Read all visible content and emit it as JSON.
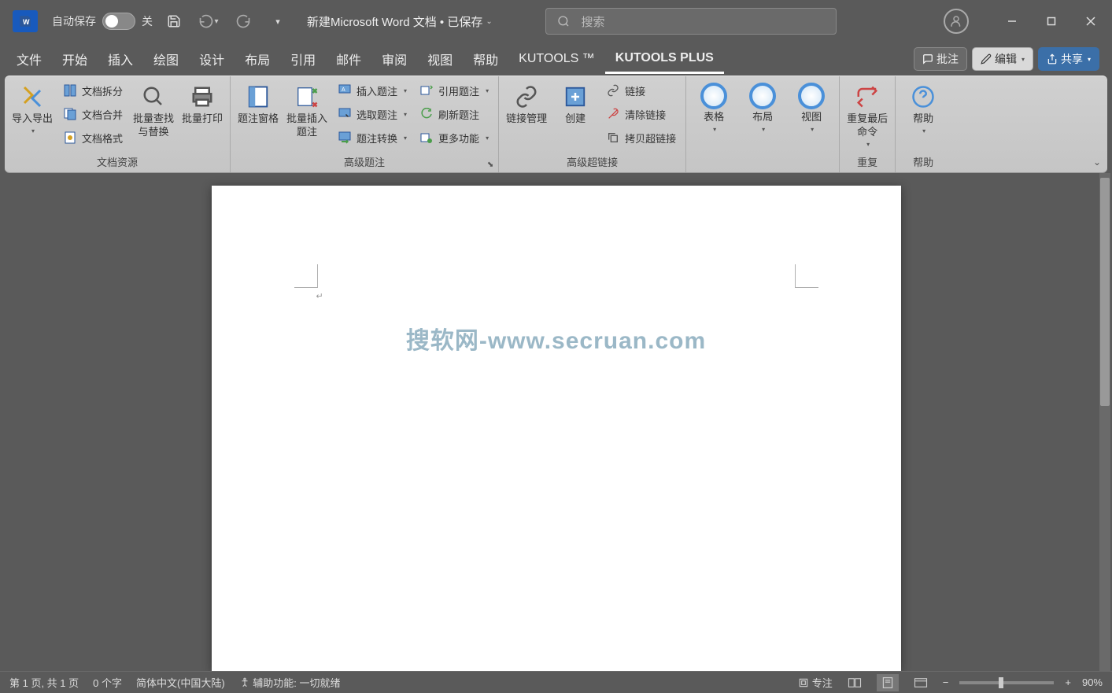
{
  "titlebar": {
    "autosave_label": "自动保存",
    "autosave_state": "关",
    "doc_title": "新建Microsoft Word 文档 • 已保存",
    "search_placeholder": "搜索"
  },
  "tabs": {
    "items": [
      "文件",
      "开始",
      "插入",
      "绘图",
      "设计",
      "布局",
      "引用",
      "邮件",
      "审阅",
      "视图",
      "帮助",
      "KUTOOLS ™",
      "KUTOOLS PLUS"
    ],
    "active_index": 12,
    "comments": "批注",
    "edit": "编辑",
    "share": "共享"
  },
  "ribbon": {
    "group1": {
      "label": "文档资源",
      "import_export": "导入导出",
      "doc_split": "文档拆分",
      "doc_merge": "文档合并",
      "doc_format": "文档格式",
      "batch_find": "批量查找与替换",
      "batch_print": "批量打印"
    },
    "group2": {
      "label": "高级题注",
      "caption_pane": "题注窗格",
      "batch_insert": "批量插入题注",
      "insert_caption": "插入题注",
      "select_caption": "选取题注",
      "caption_convert": "题注转换",
      "ref_caption": "引用题注",
      "refresh_caption": "刷新题注",
      "more_functions": "更多功能"
    },
    "group3": {
      "label": "高级超链接",
      "link_manage": "链接管理",
      "create": "创建",
      "link": "链接",
      "clear_link": "清除链接",
      "copy_link": "拷贝超链接"
    },
    "group4": {
      "table": "表格",
      "layout": "布局",
      "view": "视图"
    },
    "group5": {
      "label": "重复",
      "repeat_last": "重复最后命令"
    },
    "group6": {
      "label": "帮助",
      "help": "帮助"
    }
  },
  "document": {
    "watermark": "搜软网-www.secruan.com"
  },
  "statusbar": {
    "page_info": "第 1 页, 共 1 页",
    "word_count": "0 个字",
    "language": "简体中文(中国大陆)",
    "accessibility": "辅助功能: 一切就绪",
    "focus": "专注",
    "zoom": "90%"
  }
}
